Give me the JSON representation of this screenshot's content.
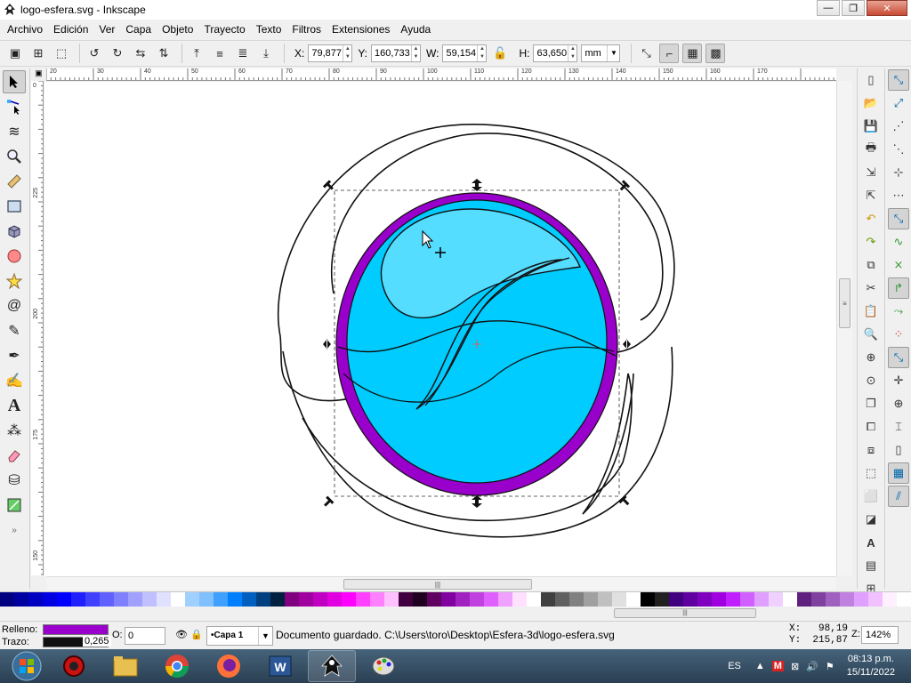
{
  "window": {
    "title": "logo-esfera.svg - Inkscape",
    "minimize": "—",
    "maximize": "❐",
    "close": "✕"
  },
  "menu": [
    "Archivo",
    "Edición",
    "Ver",
    "Capa",
    "Objeto",
    "Trayecto",
    "Texto",
    "Filtros",
    "Extensiones",
    "Ayuda"
  ],
  "controls": {
    "x_label": "X:",
    "x_value": "79,877",
    "y_label": "Y:",
    "y_value": "160,733",
    "w_label": "W:",
    "w_value": "59,154",
    "h_label": "H:",
    "h_value": "63,650",
    "unit": "mm"
  },
  "rulers": {
    "horizontal": [
      "20",
      "30",
      "40",
      "50",
      "60",
      "70",
      "80",
      "90",
      "100",
      "110",
      "120",
      "130",
      "140",
      "150",
      "160",
      "170"
    ],
    "vertical": [
      "0",
      "225",
      "200",
      "175",
      "150"
    ]
  },
  "palette": [
    "#000080",
    "#0000a0",
    "#0000c0",
    "#0000e0",
    "#0000ff",
    "#2020ff",
    "#4040ff",
    "#6060ff",
    "#8080ff",
    "#a0a0ff",
    "#c0c0ff",
    "#e0e0ff",
    "#ffffff",
    "#a0d0ff",
    "#80c0ff",
    "#40a0ff",
    "#0080ff",
    "#0060c0",
    "#004080",
    "#002040",
    "#800080",
    "#a000a0",
    "#c000c0",
    "#e000e0",
    "#ff00ff",
    "#ff40ff",
    "#ff80ff",
    "#ffc0ff",
    "#400040",
    "#200020",
    "#600060",
    "#8000a0",
    "#a020c0",
    "#c040e0",
    "#e060ff",
    "#f0a0ff",
    "#ffe0ff",
    "#ffffff",
    "#404040",
    "#606060",
    "#808080",
    "#a0a0a0",
    "#c0c0c0",
    "#e0e0e0",
    "#ffffff",
    "#000000",
    "#202020",
    "#400080",
    "#6000a0",
    "#8000c0",
    "#a000e0",
    "#c020ff",
    "#d060ff",
    "#e0a0ff",
    "#f0d0ff",
    "#ffffff",
    "#602080",
    "#8040a0",
    "#a060c0",
    "#c080e0",
    "#e0a0ff",
    "#f0c0ff",
    "#fff0ff",
    "#ffffff"
  ],
  "status": {
    "fill_label": "Relleno:",
    "fill_color": "#9900cc",
    "stroke_label": "Trazo:",
    "stroke_width": "0,265",
    "opacity_label": "O:",
    "opacity_value": "0",
    "layer": "•Capa 1",
    "message": "Documento guardado. C:\\Users\\toro\\Desktop\\Esfera-3d\\logo-esfera.svg",
    "cursor_x_label": "X:",
    "cursor_x": "98,19",
    "cursor_y_label": "Y:",
    "cursor_y": "215,87",
    "zoom_label": "Z:",
    "zoom": "142%"
  },
  "drawing": {
    "outer_ring_color": "#9900cc",
    "sphere_color": "#00ccff",
    "highlight_color": "#55ddff"
  },
  "taskbar": {
    "lang": "ES",
    "time": "08:13 p.m.",
    "date": "15/11/2022"
  }
}
